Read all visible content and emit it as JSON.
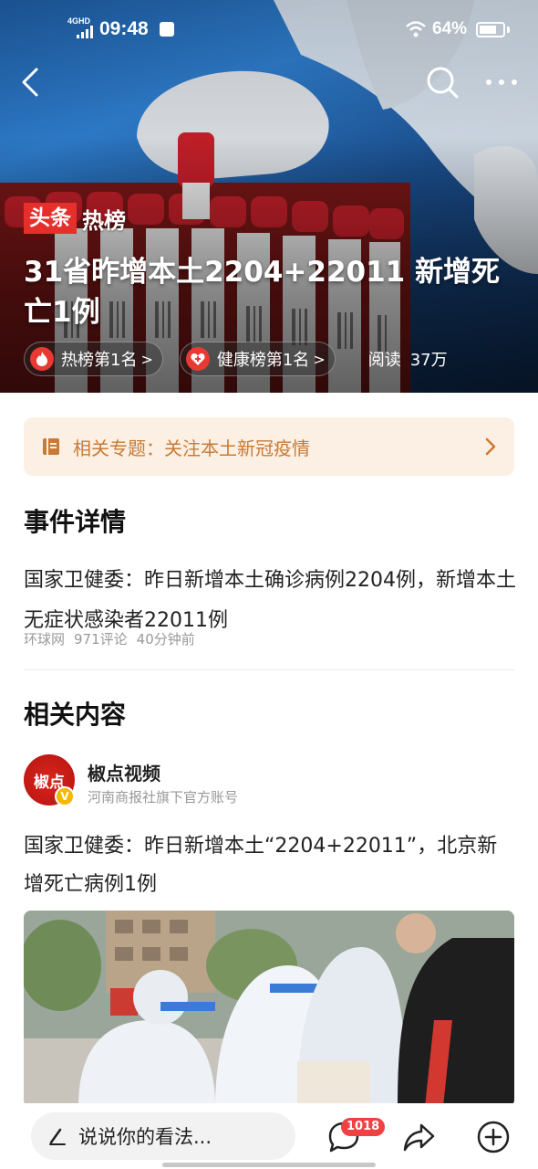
{
  "status_bar": {
    "network": "4GHD",
    "time": "09:48",
    "battery": "64%"
  },
  "hero": {
    "brand_red": "头条",
    "brand_white": "热榜",
    "title": "31省昨增本土2204+22011  新增死亡1例",
    "chips": [
      {
        "label": "热榜第1名",
        "icon": "fire-icon"
      },
      {
        "label": "健康榜第1名",
        "icon": "heart-icon"
      }
    ],
    "chip_arrow": ">",
    "reads_label": "阅读",
    "reads_value": "37万"
  },
  "topic_banner": {
    "label": "相关专题：关注本土新冠疫情",
    "icon": "book-icon"
  },
  "event": {
    "section_title": "事件详情",
    "text": "国家卫健委：昨日新增本土确诊病例2204例，新增本土无症状感染者22011例",
    "source": "环球网",
    "comments": "971评论",
    "time": "40分钟前"
  },
  "related": {
    "section_title": "相关内容",
    "author_name": "椒点视频",
    "author_sub": "河南商报社旗下官方账号",
    "avatar_text": "椒点",
    "verified_mark": "V",
    "article_title": "国家卫健委：昨日新增本土“2204+22011”，北京新增死亡病例1例"
  },
  "bottom_bar": {
    "comment_placeholder": "说说你的看法...",
    "comment_count": "1018"
  },
  "colors": {
    "brand_red": "#e52f2b",
    "topic_bg": "#fbf0e3",
    "topic_text": "#c97a35",
    "badge_red": "#f04142"
  }
}
